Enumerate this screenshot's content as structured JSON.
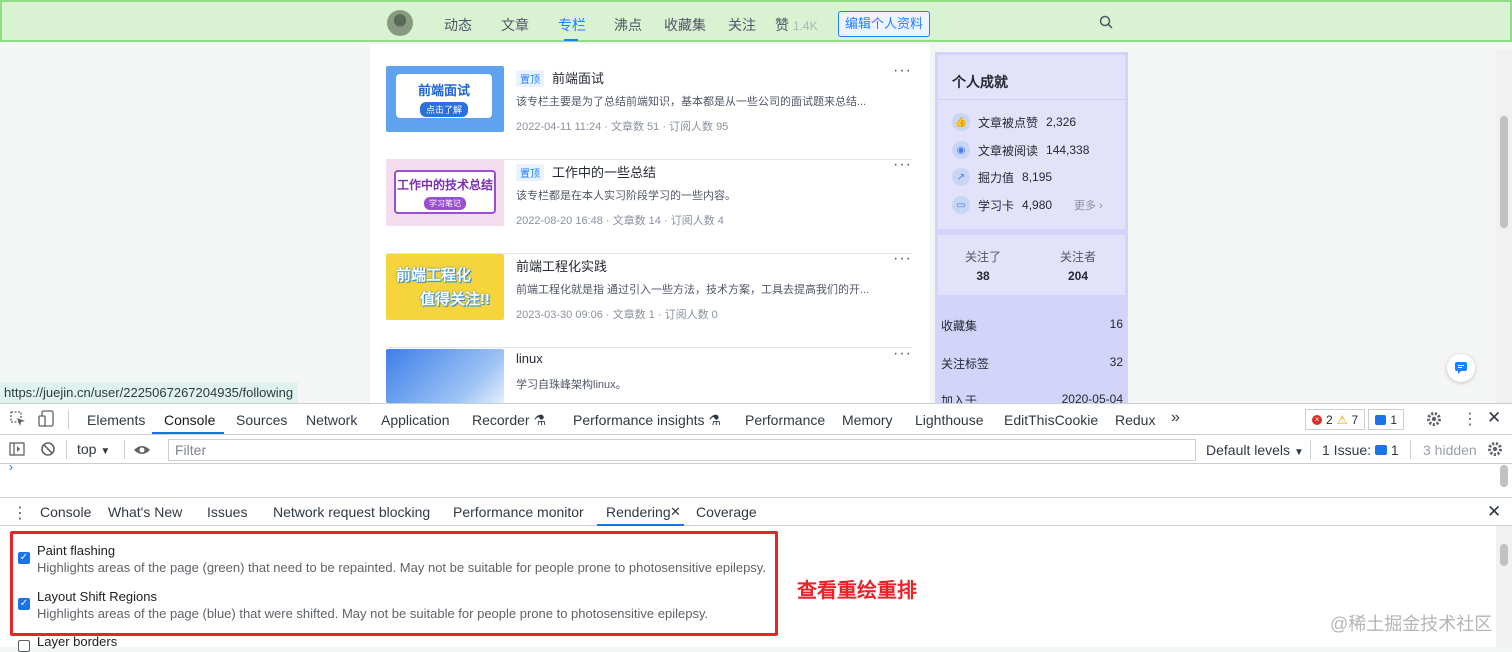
{
  "colors": {
    "accent": "#1e80ff",
    "paint_flash": "#8fdb86",
    "layout_shift": "#d4d4fa",
    "annotation": "#e8242b"
  },
  "nav": {
    "links": [
      "动态",
      "文章",
      "专栏",
      "沸点",
      "收藏集",
      "关注",
      "赞"
    ],
    "like_count": "1.4K",
    "edit_profile": "编辑个人资料",
    "search_icon": "search-icon"
  },
  "columns": [
    {
      "pin": "置顶",
      "title": "前端面试",
      "desc": "该专栏主要是为了总结前端知识，基本都是从一些公司的面试题来总结...",
      "meta": "2022-04-11 11:24 · 文章数 51 · 订阅人数 95",
      "thumb_text": "前端面试",
      "thumb_sub": "点击了解"
    },
    {
      "pin": "置顶",
      "title": "工作中的一些总结",
      "desc": "该专栏都是在本人实习阶段学习的一些内容。",
      "meta": "2022-08-20 16:48 · 文章数 14 · 订阅人数 4",
      "thumb_text": "工作中的技术总结",
      "thumb_sub": "学习笔记"
    },
    {
      "pin": "",
      "title": "前端工程化实践",
      "desc": "前端工程化就是指 通过引入一些方法，技术方案，工具去提高我们的开...",
      "meta": "2023-03-30 09:06 · 文章数 1 · 订阅人数 0",
      "thumb_text": "前端工程化",
      "thumb_sub": "值得关注!!"
    },
    {
      "pin": "",
      "title": "linux",
      "desc": "学习自珠峰架构linux。",
      "meta": "",
      "thumb_text": "",
      "thumb_sub": ""
    }
  ],
  "more": "···",
  "sidebar": {
    "title": "个人成就",
    "stats": [
      {
        "label": "文章被点赞",
        "value": "2,326",
        "icon": "thumb-up-icon"
      },
      {
        "label": "文章被阅读",
        "value": "144,338",
        "icon": "eye-icon"
      },
      {
        "label": "掘力值",
        "value": "8,195",
        "icon": "trend-icon"
      },
      {
        "label": "学习卡",
        "value": "4,980",
        "icon": "card-icon"
      }
    ],
    "more": "更多",
    "following_label": "关注了",
    "following": "38",
    "followers_label": "关注者",
    "followers": "204",
    "rows": [
      {
        "label": "收藏集",
        "value": "16"
      },
      {
        "label": "关注标签",
        "value": "32"
      },
      {
        "label": "加入于",
        "value": "2020-05-04"
      }
    ]
  },
  "link_tooltip": "https://juejin.cn/user/2225067267204935/following",
  "devtools": {
    "tabs": [
      "Elements",
      "Console",
      "Sources",
      "Network",
      "Application",
      "Recorder",
      "Performance insights",
      "Performance",
      "Memory",
      "Lighthouse",
      "EditThisCookie",
      "Redux"
    ],
    "active_tab": "Console",
    "errors": "2",
    "warnings": "7",
    "messages": "1",
    "context": "top",
    "filter_placeholder": "Filter",
    "levels": "Default levels",
    "issues": "1 Issue:",
    "issues_count": "1",
    "hidden": "3 hidden",
    "drawer_tabs": [
      "Console",
      "What's New",
      "Issues",
      "Network request blocking",
      "Performance monitor",
      "Rendering",
      "Coverage"
    ],
    "drawer_active": "Rendering",
    "rendering": [
      {
        "title": "Paint flashing",
        "desc": "Highlights areas of the page (green) that need to be repainted. May not be suitable for people prone to photosensitive epilepsy.",
        "checked": true
      },
      {
        "title": "Layout Shift Regions",
        "desc": "Highlights areas of the page (blue) that were shifted. May not be suitable for people prone to photosensitive epilepsy.",
        "checked": true
      },
      {
        "title": "Layer borders",
        "desc": "",
        "checked": false
      }
    ],
    "annotation": "查看重绘重排",
    "watermark": "@稀土掘金技术社区"
  }
}
